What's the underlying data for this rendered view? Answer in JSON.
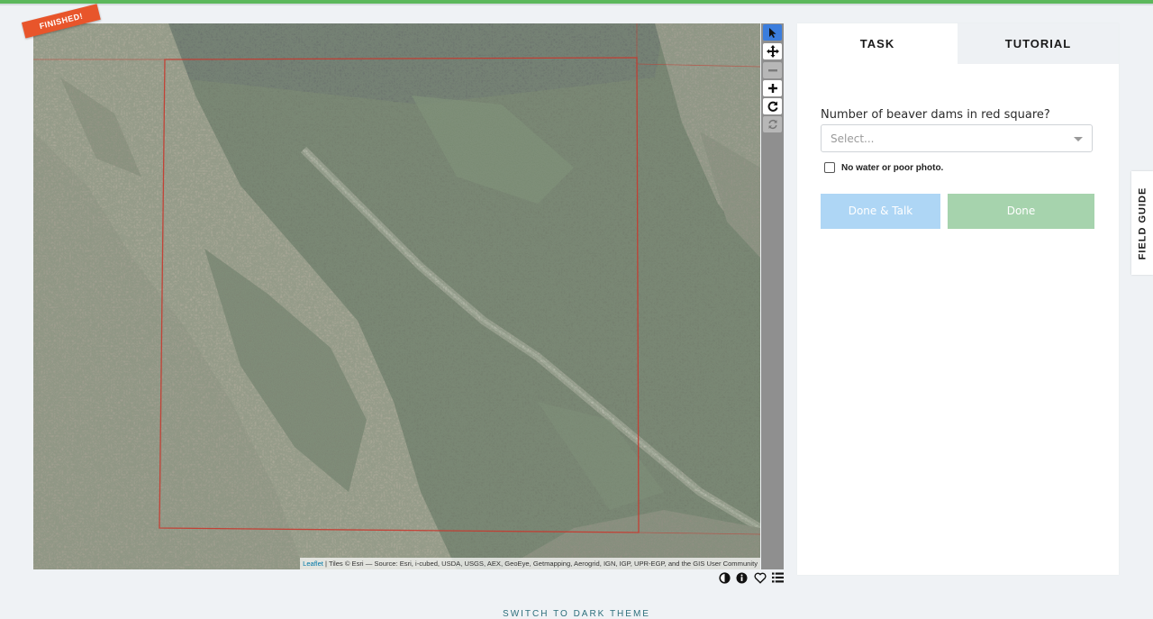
{
  "map": {
    "badge": "FINISHED!",
    "attribution_link": "Leaflet",
    "attribution_text": " | Tiles © Esri — Source: Esri, i-cubed, USDA, USGS, AEX, GeoEye, Getmapping, Aerogrid, IGN, IGP, UPR-EGP, and the GIS User Community"
  },
  "toolbar": {
    "tools": [
      "pointer-icon",
      "pan-icon",
      "zoom-out-icon",
      "zoom-in-icon",
      "rotate-icon",
      "reset-icon"
    ],
    "bottom_icons": [
      "invert-icon",
      "info-icon",
      "favorite-icon",
      "collections-icon"
    ]
  },
  "panel": {
    "tabs": [
      "TASK",
      "TUTORIAL"
    ],
    "question": "Number of beaver dams in red square?",
    "select_placeholder": "Select...",
    "checkbox_label": "No water or poor photo.",
    "done_talk_label": "Done & Talk",
    "done_label": "Done"
  },
  "field_guide_label": "FIELD GUIDE",
  "switch_theme_label": "SWITCH TO DARK THEME",
  "colors": {
    "top_bar": "#5cb85c",
    "badge": "#e8552b",
    "red_square": "#c8382d",
    "done_talk_button": "#aed6f5",
    "done_button": "#a6d3ad",
    "switch_theme_text": "#2d6f7c"
  }
}
